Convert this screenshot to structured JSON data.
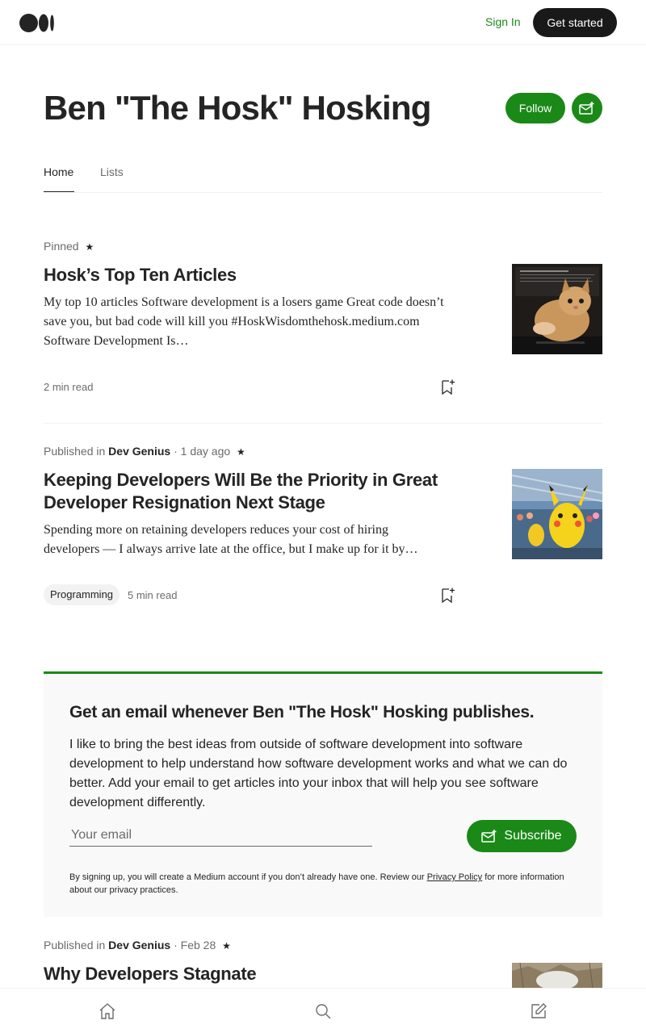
{
  "header": {
    "logo": "medium-logo",
    "signin_label": "Sign In",
    "getstarted_label": "Get started"
  },
  "profile": {
    "name": "Ben \"The Hosk\" Hosking",
    "follow_label": "Follow",
    "subscribe_icon": "mail-plus-icon"
  },
  "tabs": [
    {
      "label": "Home",
      "active": true
    },
    {
      "label": "Lists",
      "active": false
    }
  ],
  "articles": [
    {
      "pinned_label": "Pinned",
      "star": "★",
      "title": "Hosk’s Top Ten Articles",
      "excerpt": "My top 10 articles Software development is a losers game Great code doesn’t save you, but bad code will kill you #HoskWisdomthehosk.medium.com Software Development Is…",
      "read_time": "2 min read",
      "thumbnail": "kitten-on-laptop"
    },
    {
      "published_prefix": "Published in",
      "publication": "Dev Genius",
      "sep": "·",
      "date": "1 day ago",
      "star": "★",
      "title": "Keeping Developers Will Be the Priority in Great Developer Resignation Next Stage",
      "excerpt": "Spending more on retaining developers reduces your cost of hiring developers — I always arrive late at the office, but I make up for it by…",
      "tag": "Programming",
      "read_time": "5 min read",
      "thumbnail": "pikachu-parade"
    },
    {
      "published_prefix": "Published in",
      "publication": "Dev Genius",
      "sep": "·",
      "date": "Feb 28",
      "star": "★",
      "title": "Why Developers Stagnate",
      "thumbnail": "outdoor-photo"
    }
  ],
  "email_signup": {
    "title": "Get an email whenever Ben \"The Hosk\" Hosking publishes.",
    "description": "I like to bring the best ideas from outside of software development into software development to help understand how software development works and what we can do better. Add your email to get articles into your inbox that will help you see software development differently.",
    "input_placeholder": "Your email",
    "subscribe_label": "Subscribe",
    "terms_before": "By signing up, you will create a Medium account if you don’t already have one. Review our ",
    "privacy_link": "Privacy Policy",
    "terms_after": " for more information about our privacy practices."
  },
  "colors": {
    "accent_green": "#1a8917",
    "dark": "#191919",
    "muted": "#6b6b6b"
  },
  "bottom_nav": [
    "home-icon",
    "search-icon",
    "write-icon"
  ]
}
